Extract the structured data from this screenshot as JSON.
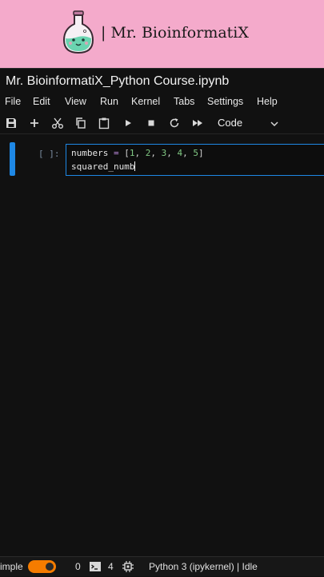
{
  "banner": {
    "brand": "| Mr. BioinformatiX",
    "colors": {
      "background": "#f4aacb",
      "flask_liquid": "#6ad4b0"
    }
  },
  "window": {
    "title": "Mr. BioinformatiX_Python Course.ipynb"
  },
  "menu": {
    "items": [
      "File",
      "Edit",
      "View",
      "Run",
      "Kernel",
      "Tabs",
      "Settings",
      "Help"
    ]
  },
  "toolbar": {
    "buttons": [
      "save-icon",
      "add-icon",
      "cut-icon",
      "copy-icon",
      "paste-icon",
      "run-icon",
      "stop-icon",
      "restart-icon",
      "fast-forward-icon"
    ],
    "cell_type": "Code"
  },
  "cell": {
    "prompt": "[ ]:",
    "line1": {
      "name": "numbers",
      "op": "=",
      "values": [
        "1",
        "2",
        "3",
        "4",
        "5"
      ]
    },
    "line2": "squared_numb"
  },
  "status": {
    "mode": "imple",
    "toggle_on": true,
    "terminals": "0",
    "kernels": "4",
    "kernel_status": "Python 3 (ipykernel) | Idle",
    "accent": "#f57c00"
  }
}
